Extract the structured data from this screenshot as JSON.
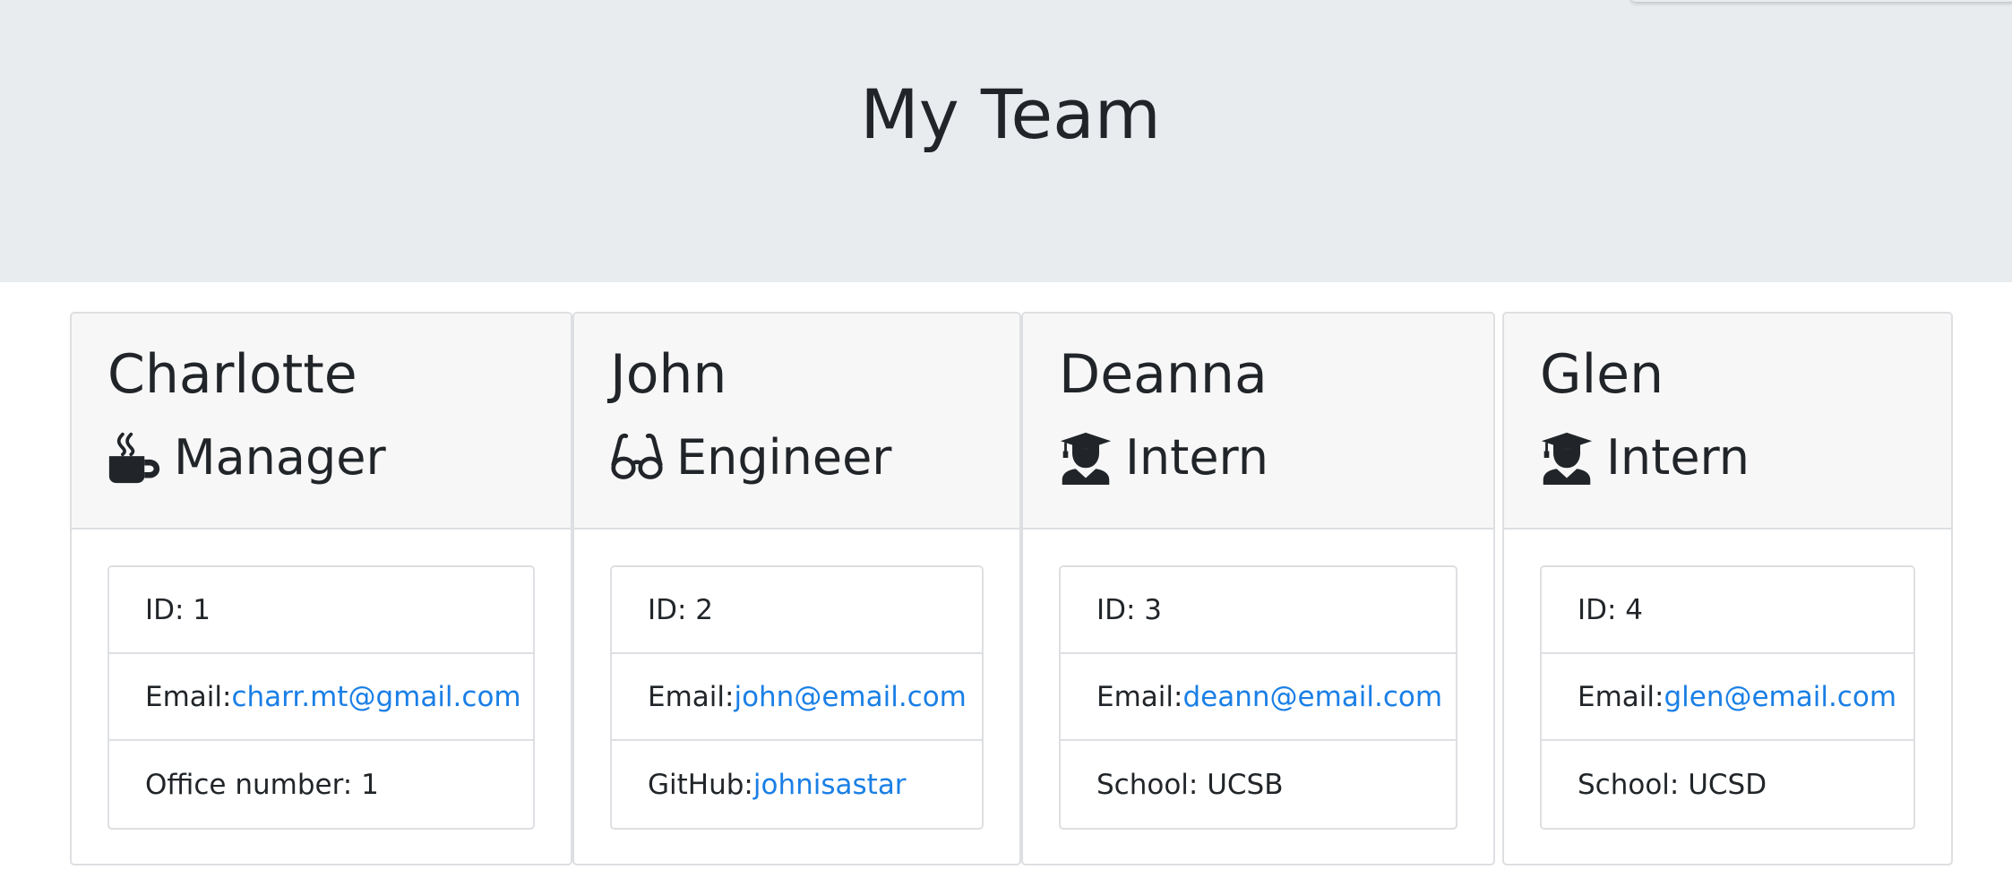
{
  "header": {
    "title": "My Team"
  },
  "colors": {
    "jumbotron_bg": "#e9ecef",
    "card_header_bg": "#f7f7f7",
    "link": "#1a7fe6",
    "text": "#212529"
  },
  "team": [
    {
      "name": "Charlotte",
      "role": "Manager",
      "icon": "coffee-icon",
      "id_label": "ID: 1",
      "email_label": "Email: ",
      "email": "charr.mt@gmail.com",
      "extra_label": "Office number: 1",
      "extra_value": ""
    },
    {
      "name": "John",
      "role": "Engineer",
      "icon": "glasses-icon",
      "id_label": "ID: 2",
      "email_label": "Email: ",
      "email": "john@email.com",
      "extra_label": "GitHub: ",
      "extra_value": "johnisastar"
    },
    {
      "name": "Deanna",
      "role": "Intern",
      "icon": "graduate-icon",
      "id_label": "ID: 3",
      "email_label": "Email: ",
      "email": "deann@email.com",
      "extra_label": "School: UCSB",
      "extra_value": ""
    },
    {
      "name": "Glen",
      "role": "Intern",
      "icon": "graduate-icon",
      "id_label": "ID: 4",
      "email_label": "Email: ",
      "email": "glen@email.com",
      "extra_label": "School: UCSD",
      "extra_value": ""
    }
  ]
}
